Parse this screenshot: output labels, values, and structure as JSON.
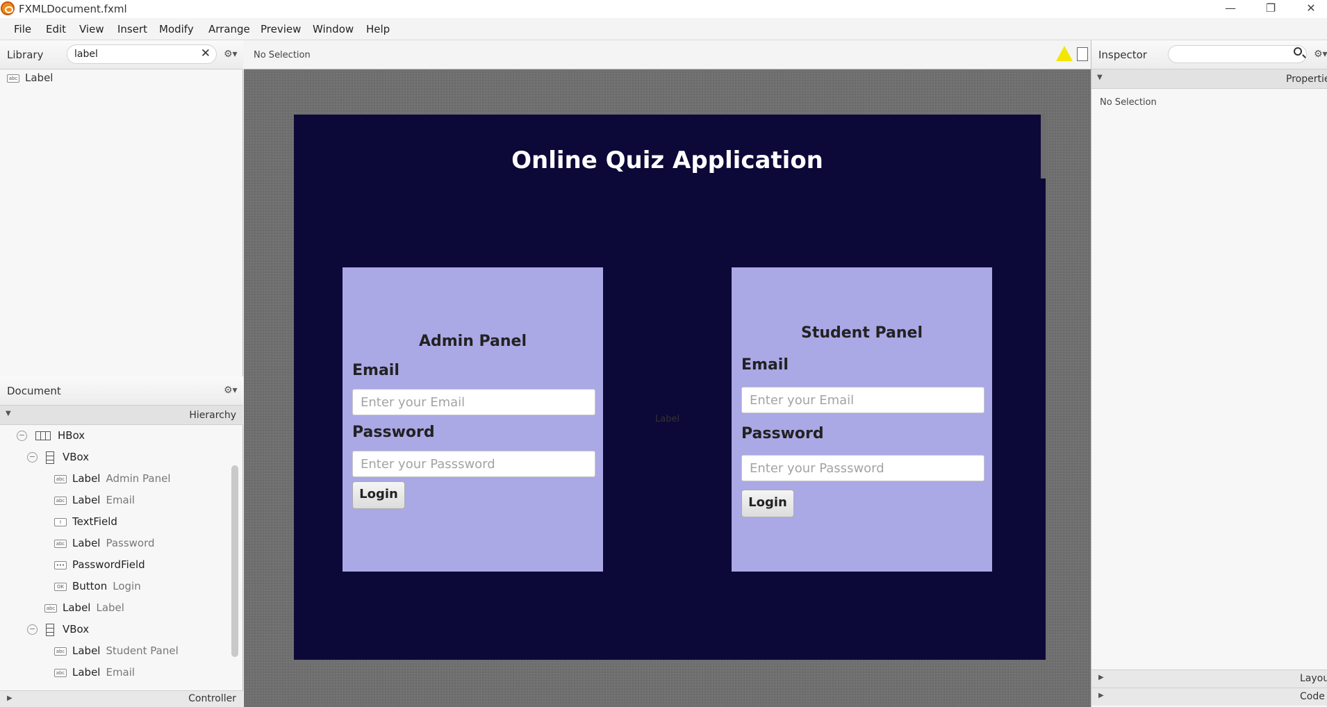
{
  "window": {
    "title": "FXMLDocument.fxml",
    "minimize": "—",
    "restore": "❐",
    "close": "✕"
  },
  "menu": [
    "File",
    "Edit",
    "View",
    "Insert",
    "Modify",
    "Arrange",
    "Preview",
    "Window",
    "Help"
  ],
  "library": {
    "title": "Library",
    "search_value": "label",
    "clear": "✕",
    "gear": "⚙▾",
    "items": [
      {
        "icon": "abc",
        "label": "Label"
      }
    ]
  },
  "document": {
    "title": "Document",
    "gear": "⚙▾",
    "hierarchy_label": "Hierarchy",
    "tree": [
      {
        "type": "HBox",
        "sub": ""
      },
      {
        "type": "VBox",
        "sub": ""
      },
      {
        "type": "Label",
        "sub": "Admin Panel"
      },
      {
        "type": "Label",
        "sub": "Email"
      },
      {
        "type": "TextField",
        "sub": ""
      },
      {
        "type": "Label",
        "sub": "Password"
      },
      {
        "type": "PasswordField",
        "sub": ""
      },
      {
        "type": "Button",
        "sub": "Login"
      },
      {
        "type": "Label",
        "sub": "Label"
      },
      {
        "type": "VBox",
        "sub": ""
      },
      {
        "type": "Label",
        "sub": "Student Panel"
      },
      {
        "type": "Label",
        "sub": "Email"
      }
    ],
    "controller_label": "Controller"
  },
  "canvas": {
    "selection": "No Selection",
    "app_title": "Online Quiz Application",
    "mid_label": "Label",
    "admin": {
      "title": "Admin Panel",
      "email_label": "Email",
      "email_placeholder": "Enter your Email",
      "password_label": "Password",
      "password_placeholder": "Enter your Passsword",
      "button": "Login"
    },
    "student": {
      "title": "Student Panel",
      "email_label": "Email",
      "email_placeholder": "Enter your Email",
      "password_label": "Password",
      "password_placeholder": "Enter your Passsword",
      "button": "Login"
    }
  },
  "inspector": {
    "title": "Inspector",
    "gear": "⚙▾",
    "properties": "Properties",
    "no_selection": "No Selection",
    "layout": "Layout",
    "code": "Code"
  },
  "colors": {
    "stage_bg": "#0c0838",
    "panel_bg": "#aba8e6",
    "canvas_bg": "#6d6d6d"
  }
}
